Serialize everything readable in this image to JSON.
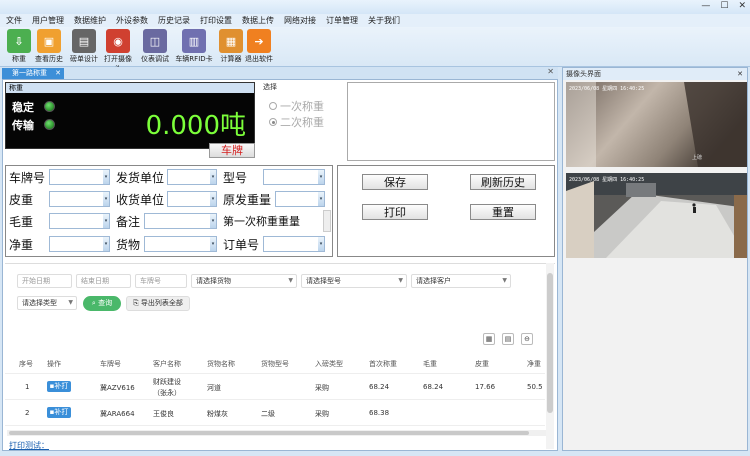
{
  "menu": [
    "文件",
    "用户管理",
    "数据维护",
    "外设参数",
    "历史记录",
    "打印设置",
    "数据上传",
    "网络对接",
    "订单管理",
    "关于我们"
  ],
  "toolbar": [
    {
      "label": "称重",
      "icon": "scale-icon",
      "color": "#4caf50"
    },
    {
      "label": "查看历史",
      "icon": "history-icon",
      "color": "#f0a030"
    },
    {
      "label": "磅单设计",
      "icon": "printer-icon",
      "color": "#555555"
    },
    {
      "label": "打开摄像头",
      "icon": "camera-icon",
      "color": "#d04030"
    },
    {
      "label": "仪表调试",
      "icon": "meter-icon",
      "color": "#6a6aa0"
    },
    {
      "label": "车辆RFID卡",
      "icon": "truck-icon",
      "color": "#7070b0"
    },
    {
      "label": "计算器",
      "icon": "calculator-icon",
      "color": "#e09030"
    },
    {
      "label": "退出软件",
      "icon": "exit-icon",
      "color": "#f08020"
    }
  ],
  "tab": {
    "label": "第一路称重"
  },
  "weigh": {
    "header": "称重",
    "stable": "稳定",
    "transfer": "传输",
    "value": "0.000吨",
    "plate_button": "车牌"
  },
  "select": {
    "label": "选择",
    "opt1": "一次称重",
    "opt2": "二次称重"
  },
  "form": {
    "plate": "车牌号",
    "sender": "发货单位",
    "model": "型号",
    "tare": "皮重",
    "receiver": "收货单位",
    "orig_weight": "原发重量",
    "gross": "毛重",
    "remark": "备注",
    "first_weight": "第一次称重重量",
    "net": "净重",
    "goods": "货物",
    "order": "订单号"
  },
  "actions": {
    "save": "保存",
    "refresh": "刷新历史",
    "print": "打印",
    "reset": "重置"
  },
  "filters": {
    "start_date": "开始日期",
    "end_date": "结束日期",
    "plate": "车牌号",
    "goods": "请选择货物",
    "model": "请选择型号",
    "customer": "请选择客户",
    "type": "请选择类型",
    "query": "查询",
    "export": "导出列表全部"
  },
  "table": {
    "headers": [
      "序号",
      "操作",
      "车牌号",
      "客户名称",
      "货物名称",
      "货物型号",
      "入磅类型",
      "首次称重",
      "毛重",
      "皮重",
      "净重"
    ],
    "print_label": "补打",
    "rows": [
      {
        "no": "1",
        "plate": "冀AZV616",
        "customer1": "财跃建设",
        "customer2": "（张永）",
        "goods": "河道",
        "model": "",
        "type": "采购",
        "first": "68.24",
        "gross": "68.24",
        "tare": "17.66",
        "net": "50.5"
      },
      {
        "no": "2",
        "plate": "冀ARA664",
        "customer1": "王俊良",
        "customer2": "",
        "goods": "粉煤灰",
        "model": "二级",
        "type": "采购",
        "first": "68.38",
        "gross": "",
        "tare": "",
        "net": ""
      }
    ]
  },
  "footer_link": "打印测试：",
  "camera": {
    "title": "摄像头界面",
    "ts1": "2023/06/08 星期四  16:40:25",
    "ts2": "2023/06/08 星期四  16:40:25",
    "label1": "上磅"
  }
}
